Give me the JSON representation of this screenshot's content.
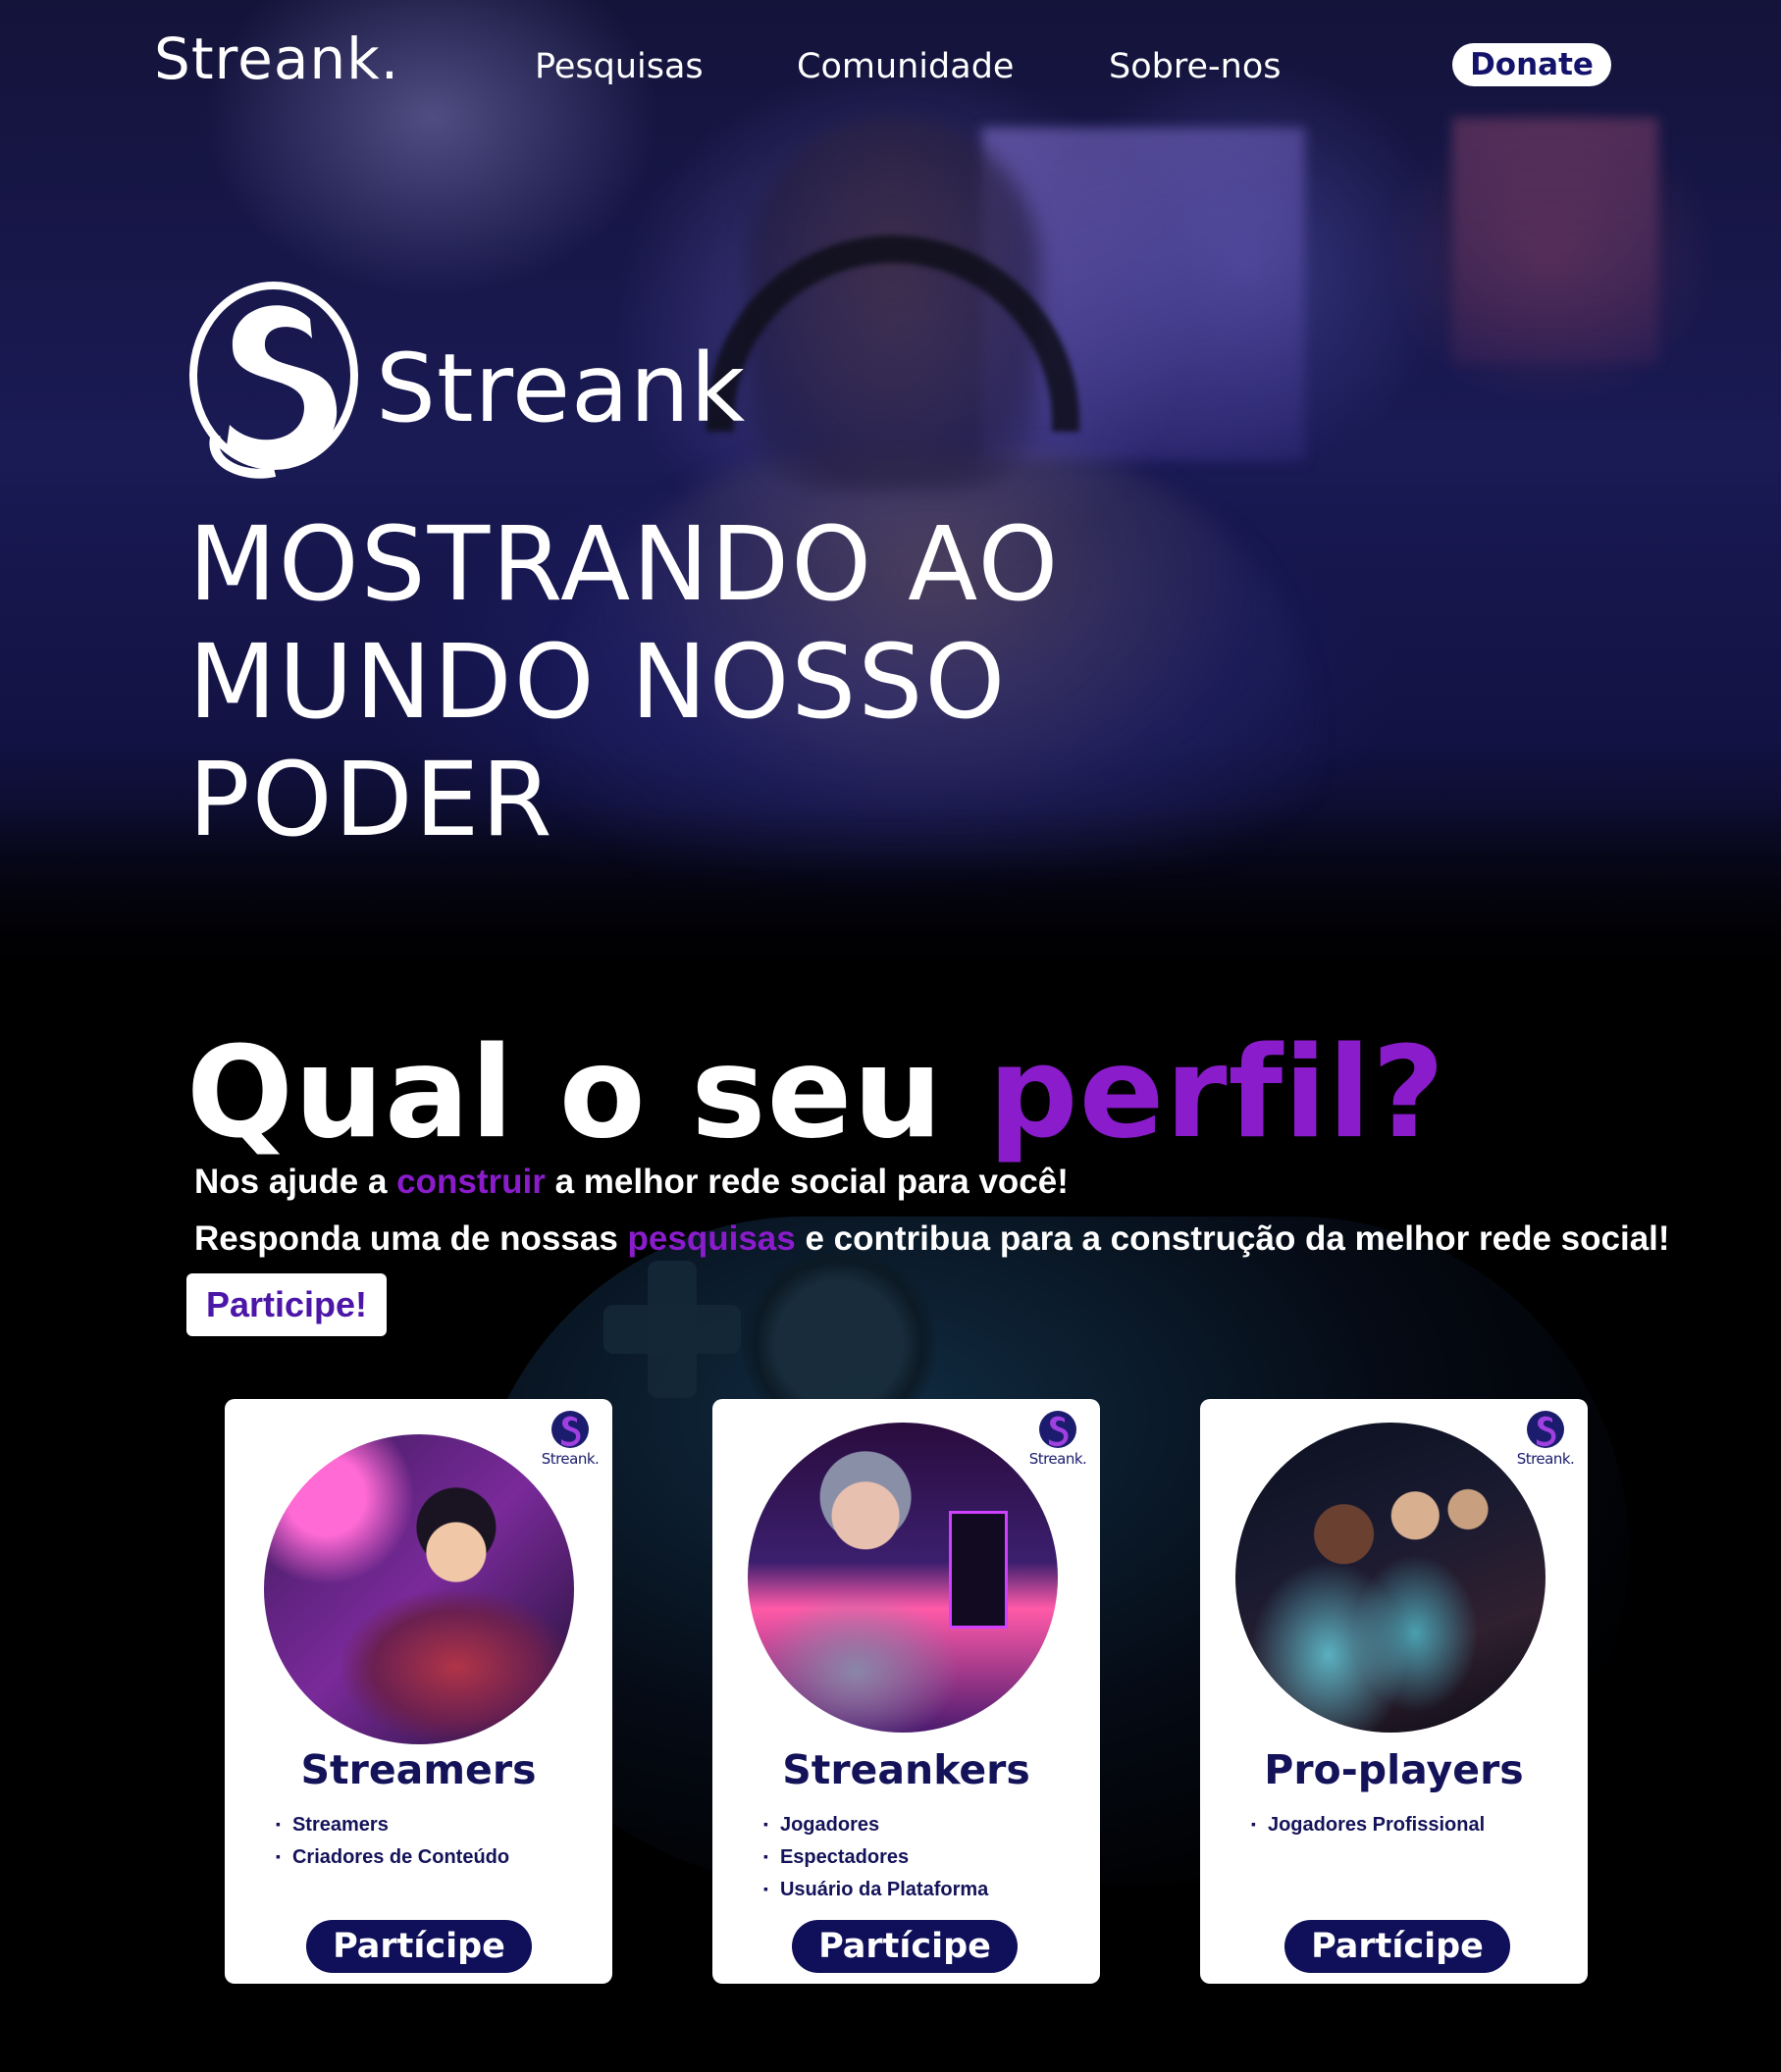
{
  "nav": {
    "logo": "Streank.",
    "links": [
      "Pesquisas",
      "Comunidade",
      "Sobre-nos"
    ],
    "donate_label": "Donate"
  },
  "hero": {
    "brand_name": "Streank",
    "headline": [
      "MOSTRANDO AO",
      "MUNDO NOSSO",
      "PODER"
    ]
  },
  "profile": {
    "title_part1": "Qual o seu ",
    "title_accent": "perfil?",
    "line1": {
      "before": "Nos ajude a ",
      "highlight": "construir",
      "after": " a melhor rede social para você!"
    },
    "line2": {
      "before": "Responda uma de nossas ",
      "highlight": "pesquisas",
      "after": " e contribua para a construção da melhor rede social!"
    },
    "participe_label": "Participe!"
  },
  "cards": [
    {
      "badge": "Streank.",
      "title": "Streamers",
      "items": [
        "Streamers",
        "Criadores de Conteúdo"
      ],
      "button": "Partícipe"
    },
    {
      "badge": "Streank.",
      "title": "Streankers",
      "items": [
        "Jogadores",
        "Espectadores",
        "Usuário da Plataforma"
      ],
      "button": "Partícipe"
    },
    {
      "badge": "Streank.",
      "title": "Pro-players",
      "items": [
        "Jogadores Profissional"
      ],
      "button": "Partícipe"
    }
  ],
  "colors": {
    "accent": "#8a1ccc",
    "navy": "#14135a",
    "button_navy": "#0f0f5a",
    "participe_text": "#4c16a8"
  },
  "icons": {
    "brand_mark": "streank-s-logo-icon"
  }
}
